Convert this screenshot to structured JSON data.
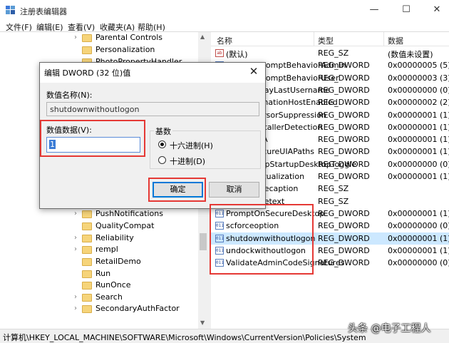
{
  "window": {
    "title": "注册表编辑器",
    "min_glyph": "—",
    "max_glyph": "☐",
    "close_glyph": "✕"
  },
  "menu": [
    "文件(F)",
    "编辑(E)",
    "查看(V)",
    "收藏夹(A)",
    "帮助(H)"
  ],
  "tree": {
    "items": [
      "Parental Controls",
      "Personalization",
      "PhotoPropertyHandler",
      "PushNotifications",
      "QualityCompat",
      "Reliability",
      "rempl",
      "RetailDemo",
      "Run",
      "RunOnce",
      "Search",
      "SecondaryAuthFactor"
    ]
  },
  "list": {
    "headers": [
      "名称",
      "类型",
      "数据"
    ],
    "rows": [
      {
        "name": "(默认)",
        "type": "REG_SZ",
        "data": "(数值未设置)",
        "icon": "sz"
      },
      {
        "name": "ConsentPromptBehaviorAdmin",
        "type": "REG_DWORD",
        "data": "0x00000005 (5)",
        "icon": "dword"
      },
      {
        "name": "ConsentPromptBehaviorUser",
        "type": "REG_DWORD",
        "data": "0x00000003 (3)",
        "icon": "dword"
      },
      {
        "name": "DontDisplayLastUsername",
        "type": "REG_DWORD",
        "data": "0x00000000 (0)",
        "icon": "dword"
      },
      {
        "name": "DSCAutomationHostEnabled",
        "type": "REG_DWORD",
        "data": "0x00000002 (2)",
        "icon": "dword"
      },
      {
        "name": "EnableCursorSuppression",
        "type": "REG_DWORD",
        "data": "0x00000001 (1)",
        "icon": "dword"
      },
      {
        "name": "EnableInstallerDetection",
        "type": "REG_DWORD",
        "data": "0x00000001 (1)",
        "icon": "dword"
      },
      {
        "name": "EnableLUA",
        "type": "REG_DWORD",
        "data": "0x00000001 (1)",
        "icon": "dword"
      },
      {
        "name": "EnableSecureUIAPaths",
        "type": "REG_DWORD",
        "data": "0x00000001 (1)",
        "icon": "dword"
      },
      {
        "name": "EnableUwpStartupDesktopToggle",
        "type": "REG_DWORD",
        "data": "0x00000000 (0)",
        "icon": "dword"
      },
      {
        "name": "EnableVirtualization",
        "type": "REG_DWORD",
        "data": "0x00000001 (1)",
        "icon": "dword"
      },
      {
        "name": "legalnoticecaption",
        "type": "REG_SZ",
        "data": "",
        "icon": "sz"
      },
      {
        "name": "legalnoticetext",
        "type": "REG_SZ",
        "data": "",
        "icon": "sz"
      },
      {
        "name": "PromptOnSecureDesktop",
        "type": "REG_DWORD",
        "data": "0x00000001 (1)",
        "icon": "dword"
      },
      {
        "name": "scforceoption",
        "type": "REG_DWORD",
        "data": "0x00000000 (0)",
        "icon": "dword"
      },
      {
        "name": "shutdownwithoutlogon",
        "type": "REG_DWORD",
        "data": "0x00000001 (1)",
        "icon": "dword"
      },
      {
        "name": "undockwithoutlogon",
        "type": "REG_DWORD",
        "data": "0x00000001 (1)",
        "icon": "dword"
      },
      {
        "name": "ValidateAdminCodeSignatures",
        "type": "REG_DWORD",
        "data": "0x00000000 (0)",
        "icon": "dword"
      }
    ]
  },
  "statusbar": {
    "path": "计算机\\HKEY_LOCAL_MACHINE\\SOFTWARE\\Microsoft\\Windows\\CurrentVersion\\Policies\\System"
  },
  "watermark": "头条 @电子工程人",
  "dialog": {
    "title": "编辑 DWORD (32 位)值",
    "close_glyph": "✕",
    "name_label": "数值名称(N):",
    "name_value": "shutdownwithoutlogon",
    "data_label": "数值数据(V):",
    "data_value": "1",
    "base_label": "基数",
    "hex_label": "十六进制(H)",
    "dec_label": "十进制(D)",
    "ok_label": "确定",
    "cancel_label": "取消"
  },
  "colors": {
    "highlight": "#e53935",
    "selection": "#cce8ff",
    "accent": "#0078d7"
  }
}
